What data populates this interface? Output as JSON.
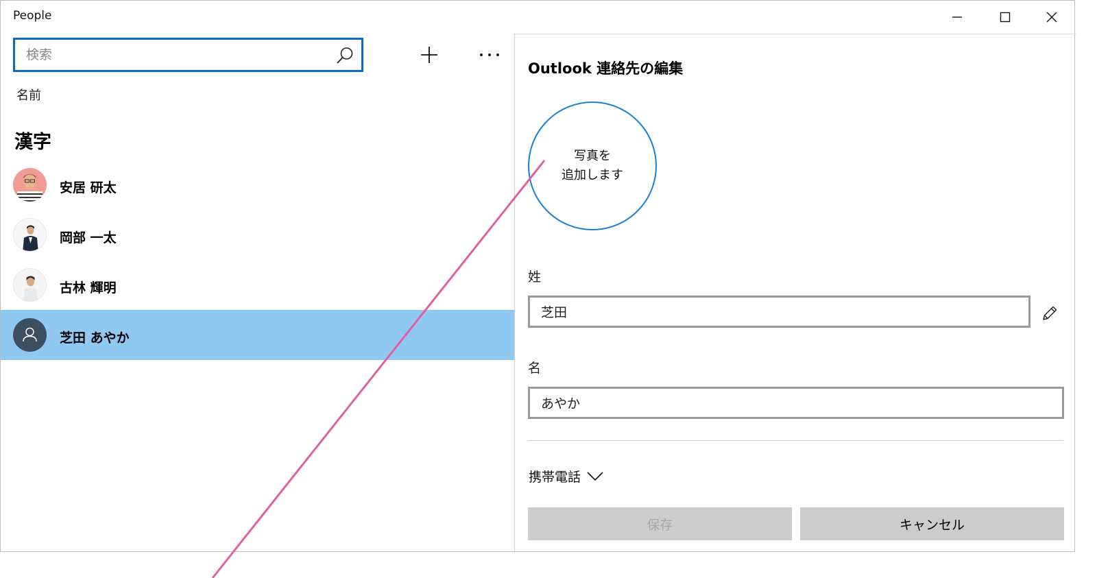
{
  "window": {
    "title": "People"
  },
  "search": {
    "placeholder": "検索",
    "value": ""
  },
  "toolbar": {
    "add_icon": "plus-icon",
    "more_icon": "more-icon"
  },
  "list": {
    "sort_label": "名前",
    "group_header": "漢字",
    "contacts": [
      {
        "name": "安居 研太",
        "avatar": "photo"
      },
      {
        "name": "岡部 一太",
        "avatar": "photo"
      },
      {
        "name": "古林 輝明",
        "avatar": "photo"
      },
      {
        "name": "芝田 あやか",
        "avatar": "person-icon",
        "selected": true
      }
    ]
  },
  "editor": {
    "title": "Outlook 連絡先の編集",
    "photo_line1": "写真を",
    "photo_line2": "追加します",
    "last_name_label": "姓",
    "last_name_value": "芝田",
    "first_name_label": "名",
    "first_name_value": "あやか",
    "phone_label": "携帯電話",
    "save_label": "保存",
    "cancel_label": "キャンセル"
  },
  "colors": {
    "accent": "#0a6cc8",
    "selection": "#8fc9f2",
    "annotation_line": "#e0609f",
    "button_bg": "#cccccc"
  }
}
